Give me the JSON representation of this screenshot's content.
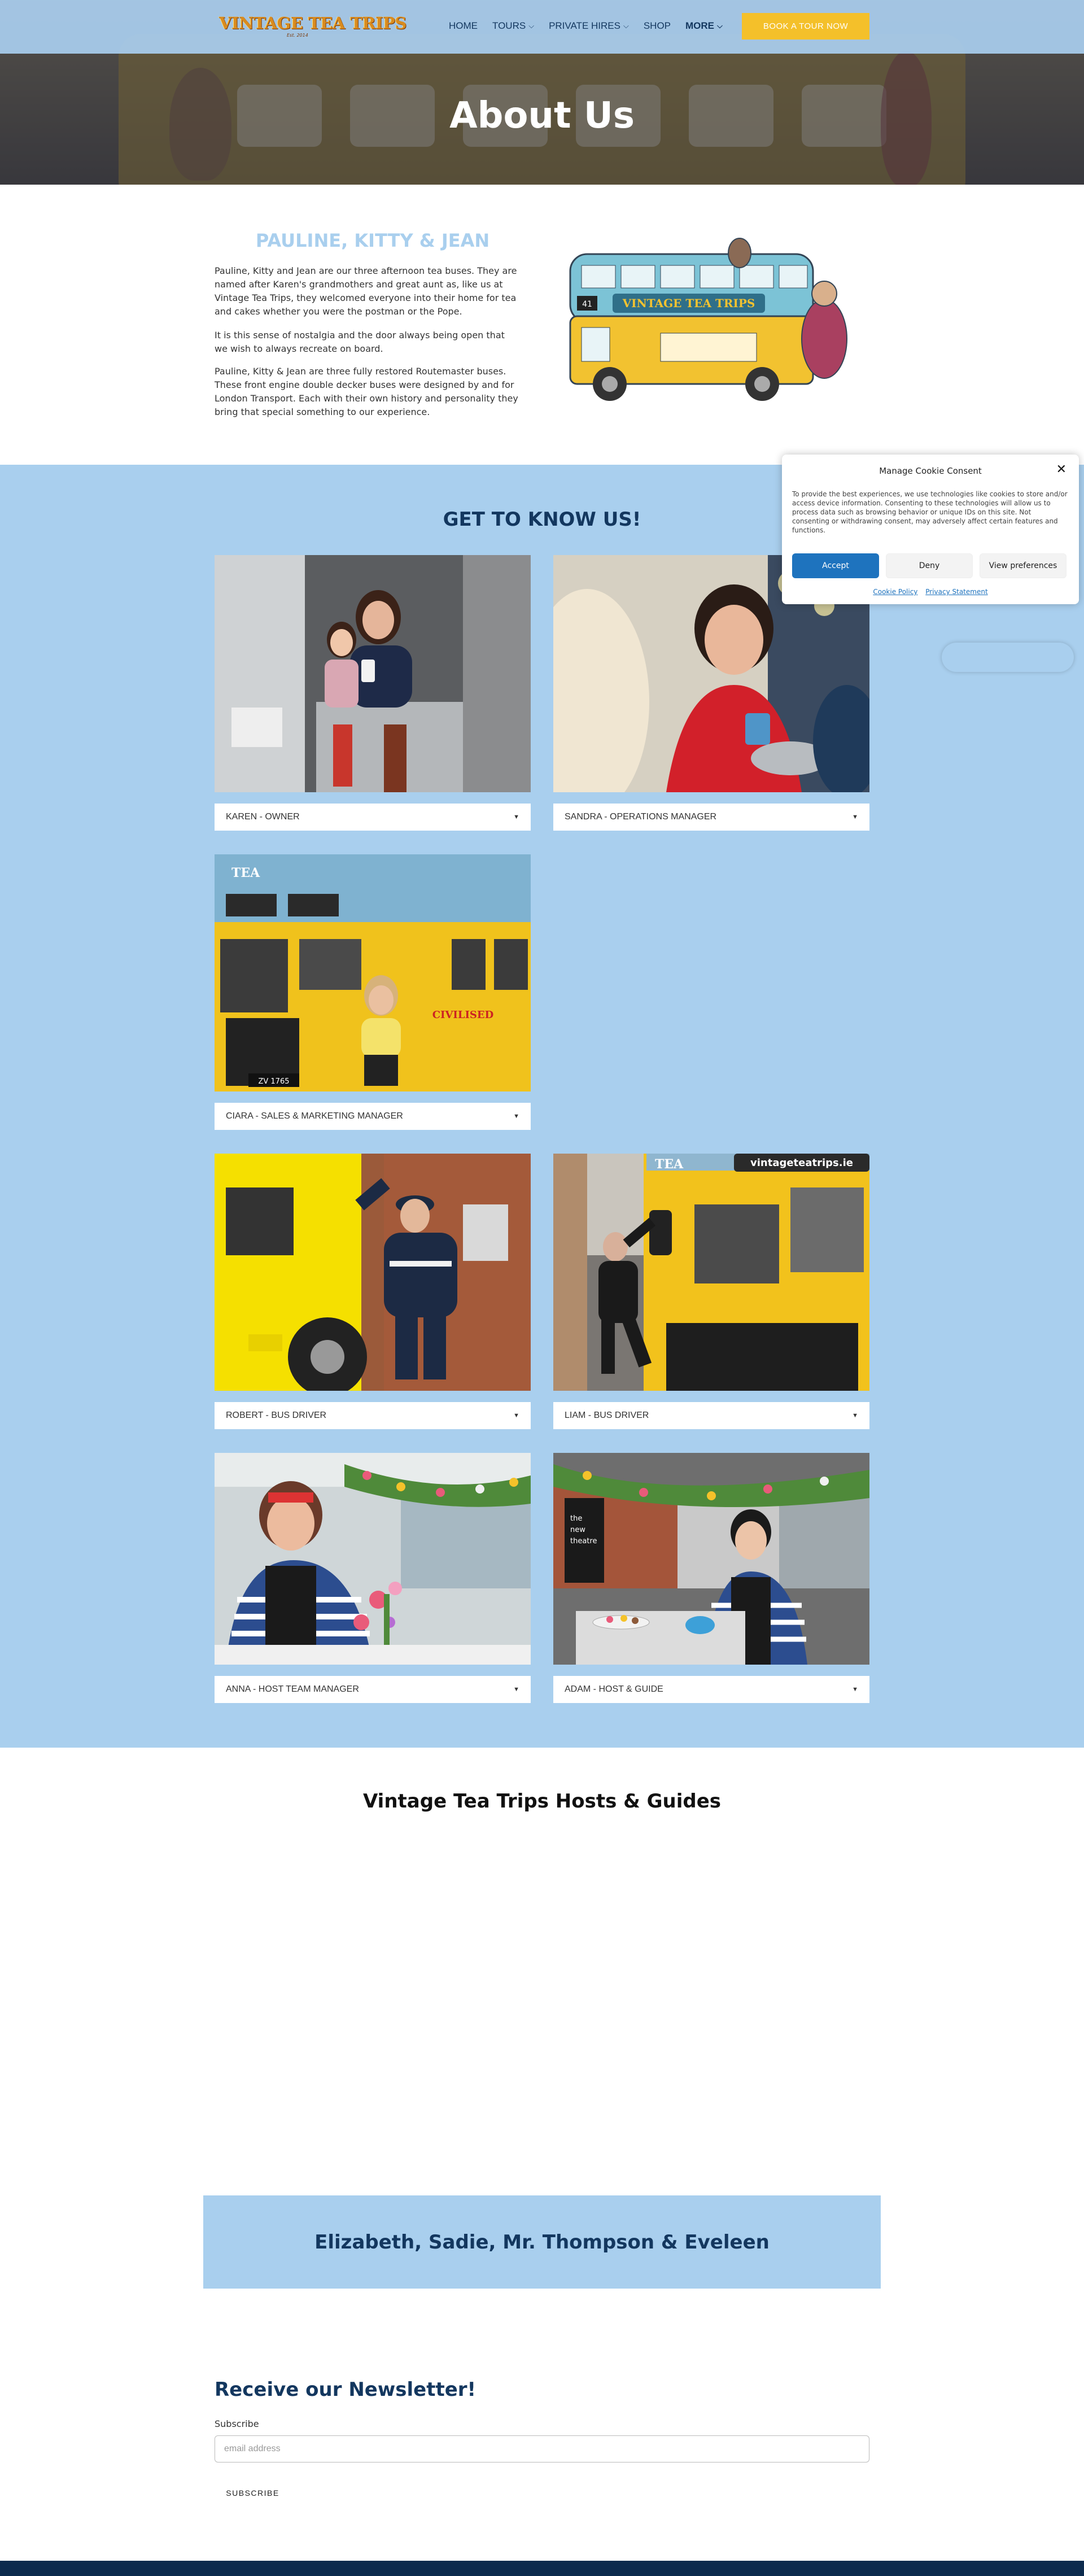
{
  "header": {
    "logo_text": "VINTAGE TEA TRIPS",
    "logo_sub": "Est. 2014",
    "nav": [
      {
        "label": "HOME",
        "dropdown": false,
        "bold": false
      },
      {
        "label": "TOURS",
        "dropdown": true,
        "bold": false
      },
      {
        "label": "PRIVATE HIRES",
        "dropdown": true,
        "bold": false
      },
      {
        "label": "SHOP",
        "dropdown": false,
        "bold": false
      },
      {
        "label": "MORE",
        "dropdown": true,
        "bold": true
      }
    ],
    "book_button": "BOOK A TOUR NOW"
  },
  "hero": {
    "title": "About Us"
  },
  "intro": {
    "title": "PAULINE, KITTY & JEAN",
    "paragraphs": [
      "Pauline, Kitty and Jean are our three afternoon tea buses. They are named after Karen's grandmothers and great aunt as, like us at Vintage Tea Trips, they welcomed everyone into their home for tea and cakes whether you were the postman or the Pope.",
      "It is this sense of nostalgia and the door always being open that we wish to always recreate on board.",
      "Pauline, Kitty & Jean are three fully restored Routemaster buses. These front engine double decker buses were designed by and for London Transport. Each with their own history and personality they bring that special something to our experience."
    ],
    "bus_sign": "VINTAGE TEA TRIPS",
    "bus_route": "41"
  },
  "team": {
    "title": "GET TO KNOW US!",
    "members": [
      {
        "label": "KAREN - OWNER"
      },
      {
        "label": "SANDRA - OPERATIONS MANAGER"
      },
      {
        "label": "CIARA - SALES & MARKETING MANAGER"
      },
      {
        "label": "ROBERT - BUS DRIVER"
      },
      {
        "label": "LIAM - BUS DRIVER"
      },
      {
        "label": "ANNA - HOST TEAM MANAGER"
      },
      {
        "label": "ADAM - HOST & GUIDE"
      }
    ],
    "photo_sign_liam": "vintageteatrips.ie",
    "photo_sign_tea": "TEA"
  },
  "hosts": {
    "title": "Vintage Tea Trips Hosts & Guides",
    "box_title": "Elizabeth, Sadie, Mr. Thompson & Eveleen"
  },
  "newsletter": {
    "title": "Receive our Newsletter!",
    "label": "Subscribe",
    "placeholder": "email address",
    "button": "SUBSCRIBE"
  },
  "cookie": {
    "title": "Manage Cookie Consent",
    "body": "To provide the best experiences, we use technologies like cookies to store and/or access device information. Consenting to these technologies will allow us to process data such as browsing behavior or unique IDs on this site. Not consenting or withdrawing consent, may adversely affect certain features and functions.",
    "accept": "Accept",
    "deny": "Deny",
    "preferences": "View preferences",
    "cookie_policy": "Cookie Policy",
    "privacy_statement": "Privacy Statement"
  },
  "colors": {
    "light_blue": "#a9cfee",
    "navy": "#13375f",
    "yellow": "#f4c02a",
    "accept_blue": "#1e73be"
  }
}
